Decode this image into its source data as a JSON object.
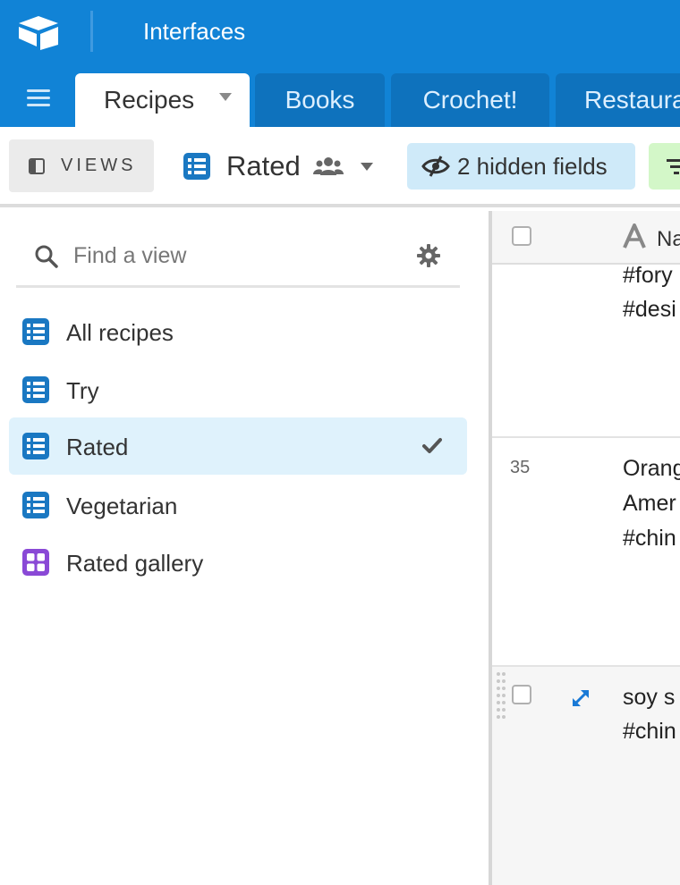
{
  "app": {
    "title": "Interfaces",
    "colors": {
      "header": "#1183d6",
      "tab_inactive": "#0e72bd",
      "selected_view": "#dff2fc",
      "hidden_fields_btn": "#cfeaf9",
      "filter_btn": "#d3f7c8",
      "grid_icon": "#1a78c2",
      "gallery_icon": "#8a49d6"
    }
  },
  "tabs": [
    {
      "label": "Recipes",
      "active": true
    },
    {
      "label": "Books",
      "active": false
    },
    {
      "label": "Crochet!",
      "active": false
    },
    {
      "label": "Restaura",
      "active": false
    }
  ],
  "toolbar": {
    "views_label": "VIEWS",
    "current_view": "Rated",
    "hidden_fields_label": "2 hidden fields",
    "icons": [
      "sidebar-toggle-icon",
      "grid-view-icon",
      "people-icon",
      "chevron-down-icon",
      "eye-slash-icon",
      "filter-icon"
    ]
  },
  "sidebar": {
    "search_placeholder": "Find a view",
    "items": [
      {
        "label": "All recipes",
        "icon": "grid-view-icon",
        "selected": false
      },
      {
        "label": "Try",
        "icon": "grid-view-icon",
        "selected": false
      },
      {
        "label": "Rated",
        "icon": "grid-view-icon",
        "selected": true
      },
      {
        "label": "Vegetarian",
        "icon": "grid-view-icon",
        "selected": false
      },
      {
        "label": "Rated gallery",
        "icon": "gallery-view-icon",
        "selected": false
      }
    ]
  },
  "grid": {
    "field_name": "Na",
    "rows": [
      {
        "number": "",
        "lines": [
          "#fory",
          "#desi"
        ]
      },
      {
        "number": "35",
        "lines": [
          "Orang",
          "Amer",
          "#chin"
        ]
      },
      {
        "number": "",
        "lines": [
          "soy s",
          "#chin"
        ]
      }
    ]
  }
}
